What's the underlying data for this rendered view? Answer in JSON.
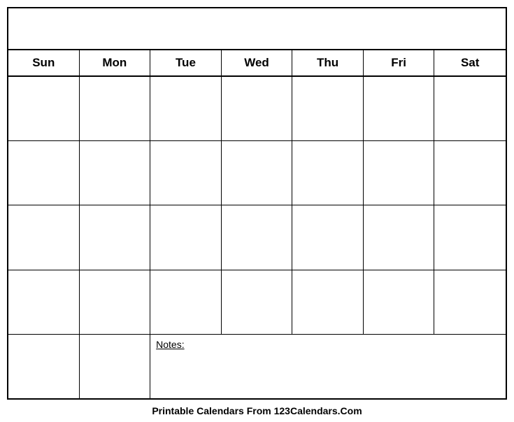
{
  "header": {
    "days": [
      "Sun",
      "Mon",
      "Tue",
      "Wed",
      "Thu",
      "Fri",
      "Sat"
    ]
  },
  "body": {
    "rows": 5,
    "notes_label": "Notes:"
  },
  "footer": {
    "text": "Printable Calendars From 123Calendars.Com"
  }
}
